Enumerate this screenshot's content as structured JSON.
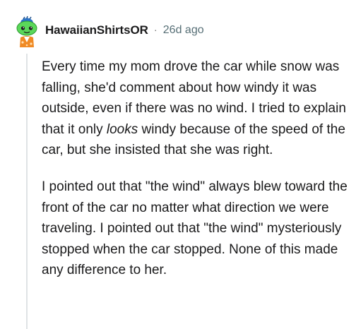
{
  "comment": {
    "author": "HawaiianShirtsOR",
    "separator": "·",
    "time_ago": "26d ago",
    "avatar_icon": "snoo-avatar-icon",
    "paragraph1": {
      "before_emphasis": "Every time my mom drove the car while snow was falling, she'd comment about how windy it was outside, even if there was no wind. I tried to explain that it only ",
      "emphasis": "looks",
      "after_emphasis": " windy because of the speed of the car, but she insisted that she was right."
    },
    "paragraph2": "I pointed out that \"the wind\" always blew toward the front of the car no matter what direction we were traveling. I pointed out that \"the wind\" mysteriously stopped when the car stopped. None of this made any difference to her."
  },
  "colors": {
    "avatar_green": "#5bd85a",
    "avatar_hat": "#2a74c7",
    "avatar_shirt": "#f08a24",
    "thread_line": "#dfe3e5",
    "meta_gray": "#576f76"
  }
}
